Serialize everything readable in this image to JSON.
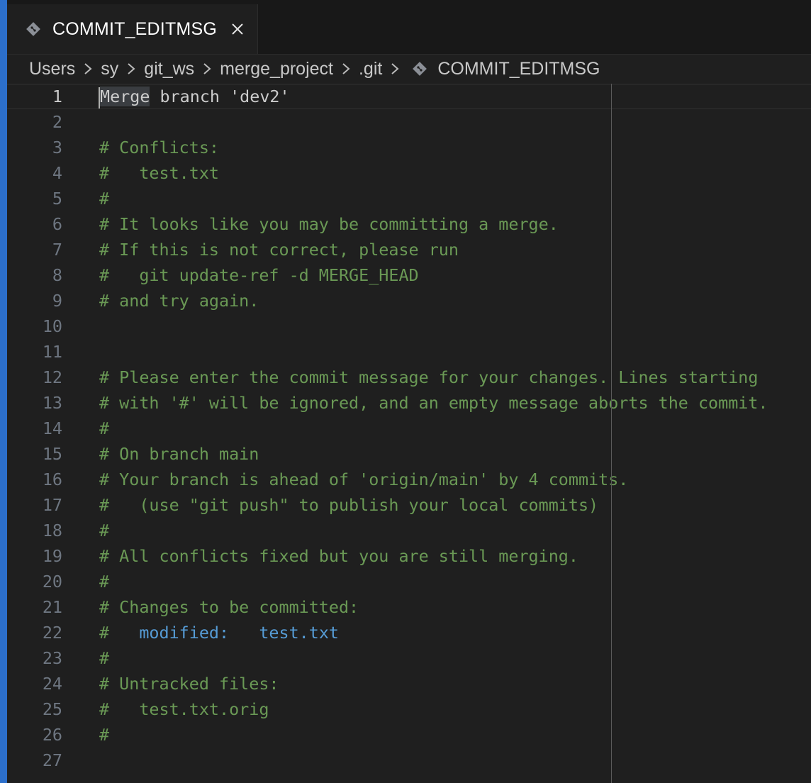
{
  "tab": {
    "label": "COMMIT_EDITMSG",
    "icon": "git-diamond-icon",
    "close_icon": "close-icon"
  },
  "breadcrumb": {
    "items": [
      "Users",
      "sy",
      "git_ws",
      "merge_project",
      ".git",
      "COMMIT_EDITMSG"
    ]
  },
  "editor": {
    "first_line": {
      "selected": "Merge",
      "rest": " branch 'dev2'"
    },
    "lines": [
      {
        "n": "1"
      },
      {
        "n": "2",
        "text": ""
      },
      {
        "n": "3",
        "text": "# Conflicts:"
      },
      {
        "n": "4",
        "text": "#   test.txt"
      },
      {
        "n": "5",
        "text": "#"
      },
      {
        "n": "6",
        "text": "# It looks like you may be committing a merge."
      },
      {
        "n": "7",
        "text": "# If this is not correct, please run"
      },
      {
        "n": "8",
        "text": "#   git update-ref -d MERGE_HEAD"
      },
      {
        "n": "9",
        "text": "# and try again."
      },
      {
        "n": "10",
        "text": ""
      },
      {
        "n": "11",
        "text": ""
      },
      {
        "n": "12",
        "text": "# Please enter the commit message for your changes. Lines starting"
      },
      {
        "n": "13",
        "text": "# with '#' will be ignored, and an empty message aborts the commit."
      },
      {
        "n": "14",
        "text": "#"
      },
      {
        "n": "15",
        "text": "# On branch main"
      },
      {
        "n": "16",
        "text": "# Your branch is ahead of 'origin/main' by 4 commits."
      },
      {
        "n": "17",
        "text": "#   (use \"git push\" to publish your local commits)"
      },
      {
        "n": "18",
        "text": "#"
      },
      {
        "n": "19",
        "text": "# All conflicts fixed but you are still merging."
      },
      {
        "n": "20",
        "text": "#"
      },
      {
        "n": "21",
        "text": "# Changes to be committed:"
      },
      {
        "n": "22",
        "prefix": "#   ",
        "keyword": "modified:   test.txt"
      },
      {
        "n": "23",
        "text": "#"
      },
      {
        "n": "24",
        "text": "# Untracked files:"
      },
      {
        "n": "25",
        "text": "#   test.txt.orig"
      },
      {
        "n": "26",
        "text": "#"
      },
      {
        "n": "27",
        "text": ""
      }
    ]
  },
  "colors": {
    "background": "#1f1f1f",
    "accent": "#2c6fcb",
    "comment": "#6a9955",
    "keyword": "#569cd6",
    "line_number": "#6e7681",
    "text": "#cccccc"
  }
}
